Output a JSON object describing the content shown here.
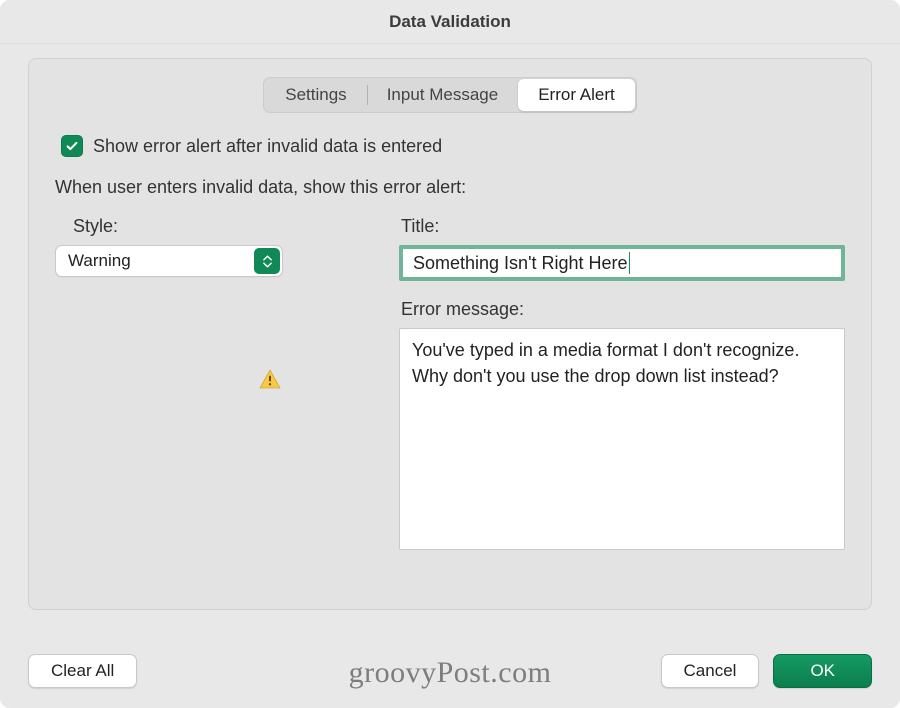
{
  "title": "Data Validation",
  "tabs": {
    "settings": "Settings",
    "input_message": "Input Message",
    "error_alert": "Error Alert"
  },
  "checkbox_label": "Show error alert after invalid data is entered",
  "instruction": "When user enters invalid data, show this error alert:",
  "style_label": "Style:",
  "style_value": "Warning",
  "title_label": "Title:",
  "title_value": "Something Isn't Right Here",
  "message_label": "Error message:",
  "message_value": "You've typed in a media format I don't recognize. Why don't you use the drop down list instead?",
  "buttons": {
    "clear_all": "Clear All",
    "cancel": "Cancel",
    "ok": "OK"
  },
  "watermark": "groovyPost.com"
}
